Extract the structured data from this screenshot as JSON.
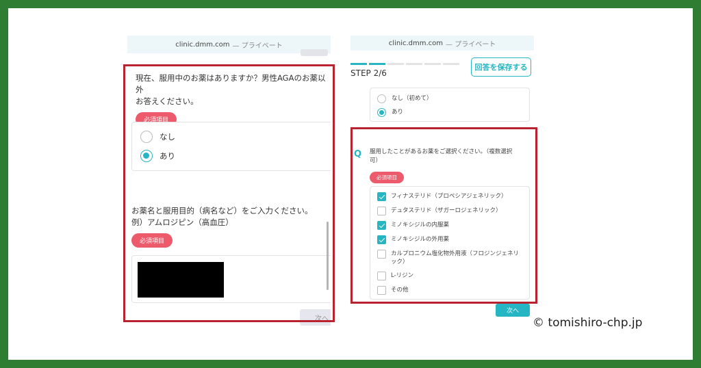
{
  "left": {
    "url": "clinic.dmm.com",
    "url_suffix": "— プライベート",
    "question1_line1": "現在、服用中のお薬はありますか？男性AGAのお薬以外",
    "question1_line2": "お答えください。",
    "required": "必須項目",
    "options": [
      "なし",
      "あり"
    ],
    "selected": "あり",
    "question2_line1": "お薬名と服用目的（病名など）をご入力ください。",
    "question2_line2": "例）アムロジピン（高血圧）",
    "next_label": "次へ"
  },
  "right": {
    "url": "clinic.dmm.com",
    "url_suffix": "— プライベート",
    "step": "STEP 2/6",
    "save_label": "回答を保存する",
    "prev_options": [
      "なし（初めて）",
      "あり"
    ],
    "prev_selected": "あり",
    "q_mark": "Q",
    "question_line1": "服用したことがあるお薬をご選択ください。（複数選択",
    "question_line2": "可）",
    "required": "必須項目",
    "checks": [
      {
        "label": "フィナステリド（プロペシアジェネリック）",
        "checked": true
      },
      {
        "label": "デュタステリド（ザガーロジェネリック）",
        "checked": false
      },
      {
        "label": "ミノキシジルの内服薬",
        "checked": true
      },
      {
        "label": "ミノキシジルの外用薬",
        "checked": true
      },
      {
        "label": "カルプロニウム塩化物外用液（フロジンジェネリック）",
        "checked": false
      },
      {
        "label": "L-リジン",
        "checked": false
      },
      {
        "label": "その他",
        "checked": false
      }
    ],
    "next_label": "次へ"
  },
  "credit": "© tomishiro-chp.jp",
  "colors": {
    "accent": "#25b5c3",
    "required": "#ec5a6b",
    "highlight": "#b8232f",
    "border_bg": "#2e7d32"
  }
}
